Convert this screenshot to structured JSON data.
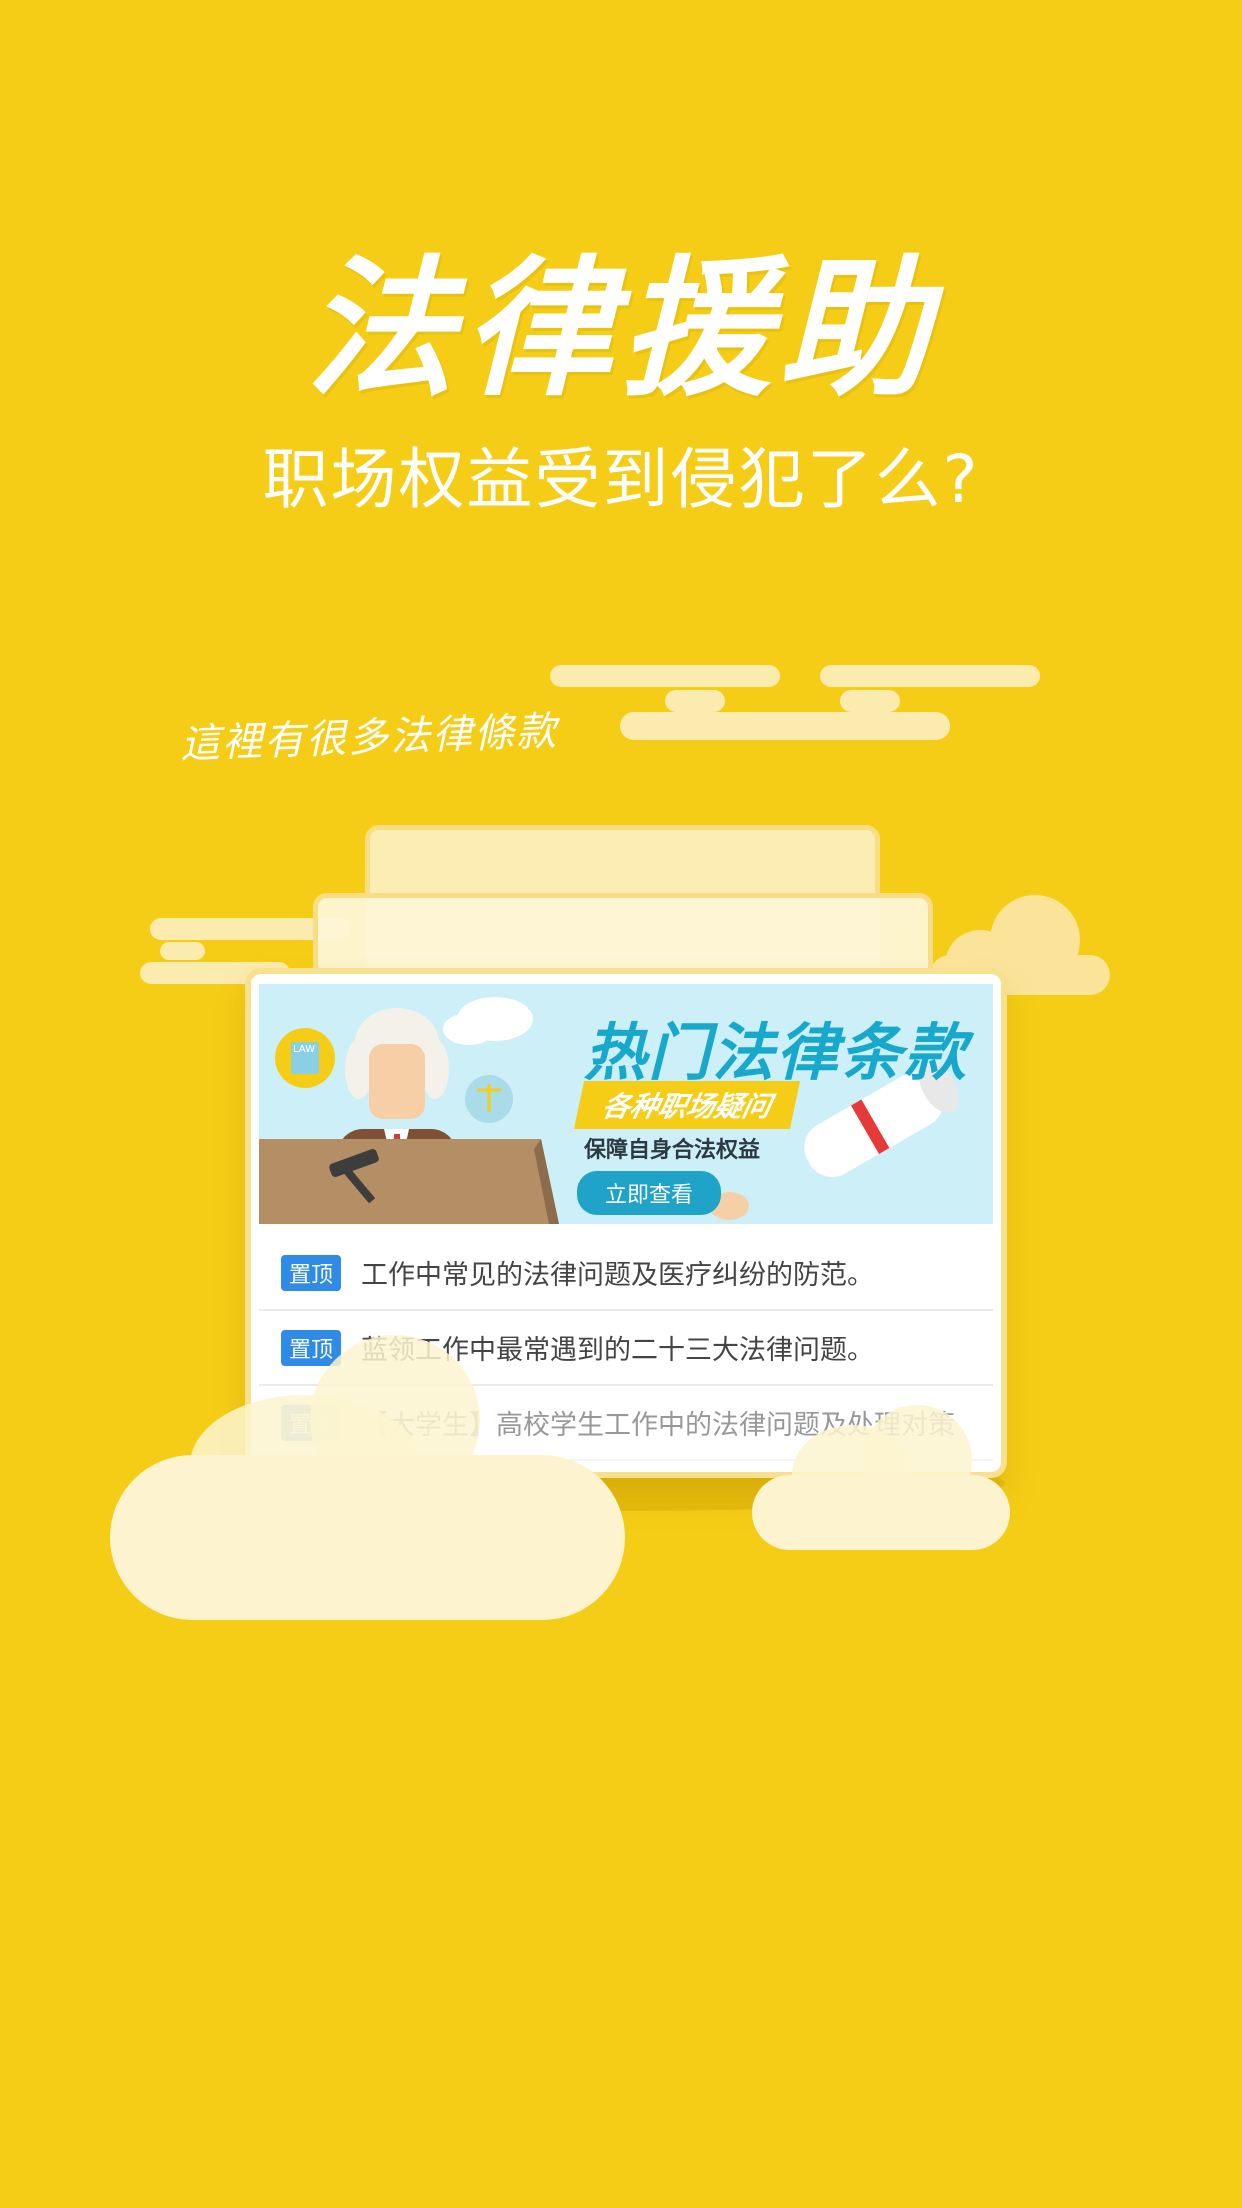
{
  "header": {
    "title": "法律援助",
    "subtitle": "职场权益受到侵犯了么?"
  },
  "tagline": "這裡有很多法律條款",
  "banner": {
    "title": "热门法律条款",
    "tag": "各种职场疑问",
    "description": "保障自身合法权益",
    "button_label": "立即查看",
    "law_label": "LAW"
  },
  "list": {
    "pin_label": "置顶",
    "items": [
      {
        "text": "工作中常见的法律问题及医疗纠纷的防范。"
      },
      {
        "text": "蓝领工作中最常遇到的二十三大法律问题。"
      },
      {
        "text": "【大学生】高校学生工作中的法律问题及处理对策"
      }
    ]
  },
  "colors": {
    "background": "#F5CD16",
    "accent_blue": "#18A8CC",
    "pin_blue": "#2F8BE6",
    "cloud": "#FDF4CF"
  }
}
